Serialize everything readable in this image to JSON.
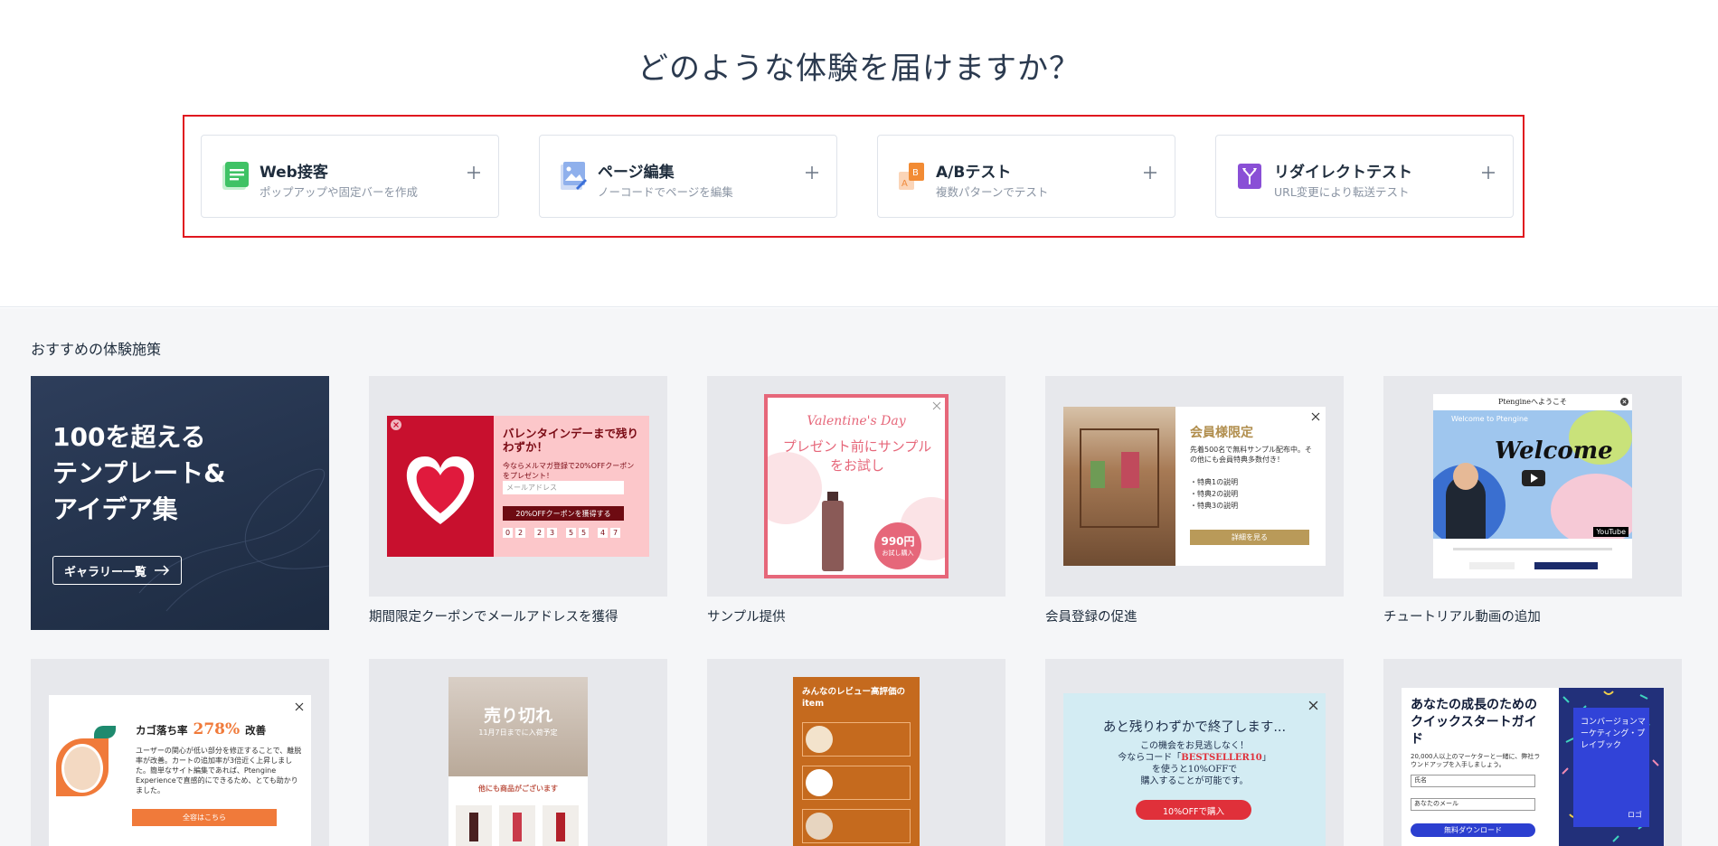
{
  "heading": "どのような体験を届けますか？",
  "types": [
    {
      "title": "Web接客",
      "subtitle": "ポップアップや固定バーを作成"
    },
    {
      "title": "ページ編集",
      "subtitle": "ノーコードでページを編集"
    },
    {
      "title": "A/Bテスト",
      "subtitle": "複数パターンでテスト"
    },
    {
      "title": "リダイレクトテスト",
      "subtitle": "URL変更により転送テスト"
    }
  ],
  "section_title": "おすすめの体験施策",
  "hero": {
    "line1": "100を超える",
    "line2": "テンプレート&",
    "line3": "アイデア集",
    "button": "ギャラリー一覧"
  },
  "templates": [
    {
      "label": "期間限定クーポンでメールアドレスを獲得"
    },
    {
      "label": "サンプル提供"
    },
    {
      "label": "会員登録の促進"
    },
    {
      "label": "チュートリアル動画の追加"
    }
  ],
  "previews": {
    "valentine": {
      "title": "バレンタインデーまで残りわずか！",
      "text": "今ならメルマガ登録で20%OFFクーポンをプレゼント！",
      "placeholder": "メールアドレス",
      "button": "20%OFFクーポンを獲得する",
      "digits": [
        "0",
        "2",
        "2",
        "3",
        "5",
        "5",
        "4",
        "7"
      ]
    },
    "sample": {
      "script": "Valentine's Day",
      "title": "プレゼント前にサンプルをお試し",
      "price": "990円",
      "price_sub": "お試し購入"
    },
    "member": {
      "title": "会員様限定",
      "text": "先着500名で無料サンプル配布中。その他にも会員特典多数付き！",
      "items": [
        "・特典1の説明",
        "・特典2の説明",
        "・特典3の説明"
      ],
      "button": "詳細を見る"
    },
    "tutorial": {
      "title": "Ptengineへようこそ",
      "video_title": "Welcome to Ptengine",
      "welcome": "Welcome",
      "brand": "YouTube"
    },
    "cart": {
      "label": "カゴ落ち率",
      "rate": "278%",
      "suffix": "改善",
      "text": "ユーザーの関心が低い部分を修正することで、離脱率が改善。カートの追加率が3倍近く上昇しました。簡単なサイト編集であれば、Ptengine Experienceで直感的にできるため、とても助かりました。",
      "button": "全容はこちら"
    },
    "soldout": {
      "title": "売り切れ",
      "sub": "11月7日までに入荷予定",
      "other": "他にも商品がございます"
    },
    "reviews": {
      "title": "みんなのレビュー高評価のitem"
    },
    "lastchance": {
      "title": "あと残りわずかで終了します...",
      "line1": "この機会をお見逃しなく！",
      "line2a": "今ならコード「",
      "code": "BESTSELLER10",
      "line2b": "」",
      "line3": "を使うと10%OFFで",
      "line4": "購入することが可能です。",
      "button": "10%OFFで購入"
    },
    "guide": {
      "title": "あなたの成長のためのクイックスタートガイド",
      "text": "20,000人以上のマーケターと一緒に、弊社ラウンドアップを入手しましょう。",
      "field1": "氏名",
      "field2": "あなたのメール",
      "button": "無料ダウンロード",
      "side": "コンバージョンマーケティング・プレイブック",
      "logo": "ロゴ"
    }
  },
  "colors": {
    "accent_red": "#e0171f",
    "hero_bg": "#2e3e5b",
    "heading": "#2b3a4f"
  }
}
